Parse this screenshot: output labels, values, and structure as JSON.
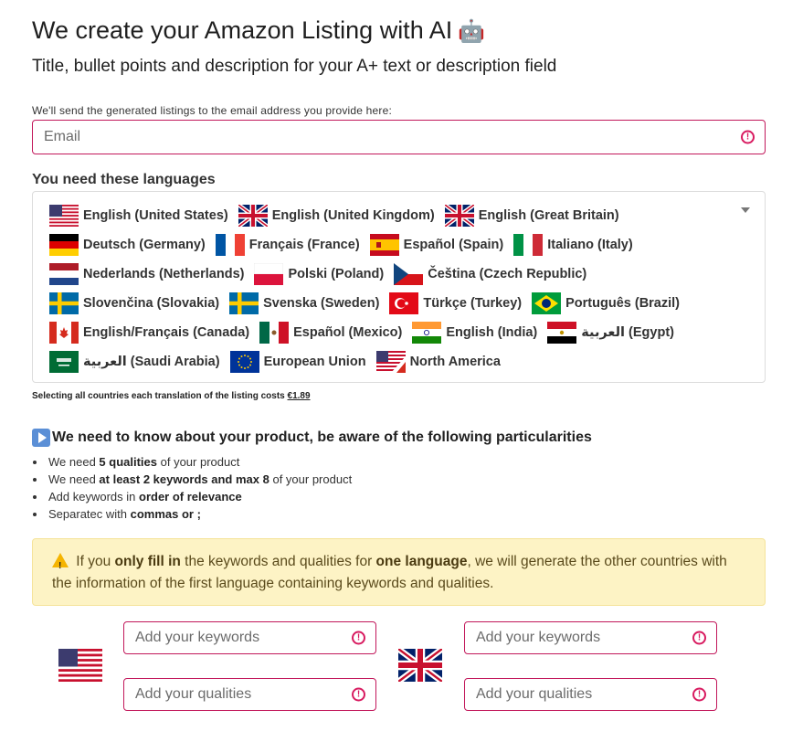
{
  "header": {
    "title": "We create your Amazon Listing with AI",
    "title_emoji": "🤖",
    "subtitle": "Title, bullet points and description for your A+ text or description field"
  },
  "email": {
    "label": "We'll send the generated listings to the email address you provide here:",
    "placeholder": "Email"
  },
  "languages": {
    "label": "You need these languages",
    "rows": [
      [
        {
          "flag": "us-flag-icon",
          "label": "English (United States)"
        },
        {
          "flag": "uk-flag-icon",
          "label": "English (United Kingdom)"
        },
        {
          "flag": "uk-flag-icon",
          "label": "English (Great Britain)"
        }
      ],
      [
        {
          "flag": "germany-flag-icon",
          "label": "Deutsch (Germany)"
        },
        {
          "flag": "france-flag-icon",
          "label": "Français (France)"
        },
        {
          "flag": "spain-flag-icon",
          "label": "Español (Spain)"
        },
        {
          "flag": "italy-flag-icon",
          "label": "Italiano (Italy)"
        }
      ],
      [
        {
          "flag": "netherlands-flag-icon",
          "label": "Nederlands (Netherlands)"
        },
        {
          "flag": "poland-flag-icon",
          "label": "Polski (Poland)"
        },
        {
          "flag": "czech-flag-icon",
          "label": "Čeština (Czech Republic)"
        }
      ],
      [
        {
          "flag": "sweden-flag-icon",
          "label": "Slovenčina (Slovakia)"
        },
        {
          "flag": "sweden-flag-icon",
          "label": "Svenska (Sweden)"
        },
        {
          "flag": "turkey-flag-icon",
          "label": "Türkçe (Turkey)"
        },
        {
          "flag": "brazil-flag-icon",
          "label": "Português (Brazil)"
        }
      ],
      [
        {
          "flag": "canada-flag-icon",
          "label": "English/Français (Canada)"
        },
        {
          "flag": "mexico-flag-icon",
          "label": "Español (Mexico)"
        },
        {
          "flag": "india-flag-icon",
          "label": "English (India)"
        },
        {
          "flag": "egypt-flag-icon",
          "label": "العربية (Egypt)"
        }
      ],
      [
        {
          "flag": "saudi-flag-icon",
          "label": "العربية (Saudi Arabia)"
        },
        {
          "flag": "eu-flag-icon",
          "label": "European Union"
        },
        {
          "flag": "us-canada-flag-icon",
          "label": "North America"
        }
      ]
    ],
    "cost_note_prefix": "Selecting all countries each translation of the listing costs ",
    "cost_note_price": "€1.89"
  },
  "product_info": {
    "title": "We need to know about your product, be aware of the following particularities",
    "bullets": [
      {
        "pre": "We need ",
        "bold": "5 qualities",
        "post": " of your product"
      },
      {
        "pre": "We need ",
        "bold": "at least 2 keywords and max 8",
        "post": " of your product"
      },
      {
        "pre": "Add keywords in ",
        "bold": "order of relevance",
        "post": ""
      },
      {
        "pre": "Separatec with ",
        "bold": "commas or ;",
        "post": ""
      }
    ]
  },
  "warning": {
    "t1": " If you ",
    "b1": "only fill in",
    "t2": " the keywords and qualities for ",
    "b2": "one language",
    "t3": ", we will generate the other countries with the information of the first language containing keywords and qualities."
  },
  "inputs": {
    "keywords_placeholder": "Add your keywords",
    "qualities_placeholder": "Add your qualities"
  },
  "colors": {
    "field_border": "#c2185b",
    "alert": "#d81b60",
    "warning_bg": "#fdf3c5"
  }
}
